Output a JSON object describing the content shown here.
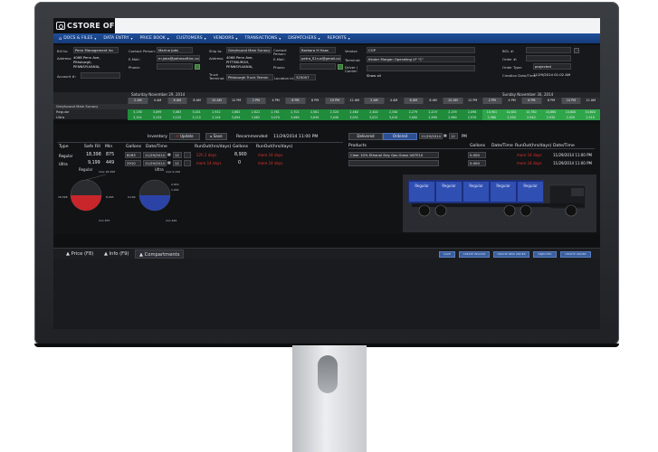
{
  "app": {
    "logo_text": "CSTORE OFFICE"
  },
  "menu": [
    {
      "label": "DOCS & FILES",
      "icon": "home-icon"
    },
    {
      "label": "DATA ENTRY"
    },
    {
      "label": "PRICE BOOK"
    },
    {
      "label": "CUSTOMERS"
    },
    {
      "label": "VENDORS"
    },
    {
      "label": "TRANSACTIONS"
    },
    {
      "label": "DISPATCHERS"
    },
    {
      "label": "REPORTS"
    }
  ],
  "billing": {
    "bill_to_label": "Bill to:",
    "bill_to_value": "Penn Management Inc",
    "address_label": "Address:",
    "address_lines": [
      "4068 Penn Ave,",
      "Pittsburgh,",
      "PENNSYLVANIA,"
    ],
    "account_label": "Account #:",
    "contact_label": "Contact Person:",
    "contact_value": "Marina Jobs",
    "email_label": "E-Mail:",
    "email_value": "m.jobs@petrosoftinc.co",
    "phone_label": "Phone:"
  },
  "shipping": {
    "ship_to_label": "Ship to:",
    "ship_to_value": "Greyhound Main Sunocy",
    "address_label": "Address:",
    "address_lines": [
      "4068 Penn Ave,",
      "PITTSBURGH,",
      "PENNSYLVANIA,"
    ],
    "truck_terminal_label": "Truck Terminal:",
    "truck_terminal_value": "Pittsburgh Truck Termin",
    "location_id_label": "Location Id:",
    "location_id_value": "325007",
    "contact_label": "Contact Person:",
    "contact_value": "Barbara H Haas",
    "email_label": "E-Mail:",
    "email_value": "petro_S1rus@gmail.com",
    "phone_label": "Phone:"
  },
  "vendor": {
    "vendor_label": "Vendor:",
    "vendor_value": "COP",
    "terminal_label": "Terminal:",
    "terminal_value": "Kinder Morgan Operating LP \"C\"",
    "driver_carrier_label": "Driver / Carrier:",
    "show_all": "Show all"
  },
  "order": {
    "bol_label": "BOL #:",
    "order_label": "Order #:",
    "order_type_label": "Order Type:",
    "order_type_value": "projected",
    "creation_label": "Creation Date/Time",
    "creation_value": "11/29/2014 01:02 AM"
  },
  "schedule": {
    "day1": "Saturday November 29, 2014",
    "day2": "Sunday November 30, 2014",
    "hours": [
      "2 AM",
      "4 AM",
      "6 AM",
      "8 AM",
      "10 AM",
      "12 PM",
      "2 PM",
      "4 PM",
      "6 PM",
      "8 PM",
      "10 PM",
      "12 AM",
      "2 AM",
      "4 AM",
      "6 AM",
      "8 AM",
      "10 AM",
      "12 PM",
      "2 PM",
      "4 PM",
      "6 PM",
      "8 PM",
      "10 PM",
      "12 AM"
    ],
    "rows": [
      {
        "label": "Greyhound Main Sunocy",
        "values": []
      },
      {
        "label": "Regular",
        "values": [
          "3,136",
          "3,099",
          "3,063",
          "3,001",
          "2,942",
          "2,882",
          "2,822",
          "2,761",
          "2,701",
          "2,581",
          "2,520",
          "2,460",
          "2,400",
          "2,340",
          "2,279",
          "2,219",
          "2,159",
          "2,098",
          "10,901",
          "10,841",
          "10,780",
          "10,660",
          "10,600",
          "10,600"
        ]
      },
      {
        "label": "Ultra",
        "values": [
          "3,144",
          "3,134",
          "3,125",
          "3,115",
          "3,104",
          "3,094",
          "3,082",
          "3,070",
          "3,060",
          "3,050",
          "3,040",
          "3,031",
          "3,021",
          "3,010",
          "3,000",
          "2,990",
          "2,980",
          "2,970",
          "2,960",
          "2,950",
          "2,940",
          "2,930",
          "2,920",
          "2,910"
        ]
      }
    ]
  },
  "inventory": {
    "title": "Inventory",
    "update_label": "Update",
    "save_label": "Save",
    "recommended_label": "Recommended",
    "recommended_value": "11/29/2014 11:00 PM",
    "columns": [
      "Type",
      "Safe Fill",
      "Min",
      "Gallons",
      "Date/Time",
      "RunOut(hrs/days)",
      "RunOut(hrs/days)"
    ],
    "rows": [
      {
        "type": "Regular",
        "safe_fill": "18,398",
        "min": "875",
        "gallons": "8263",
        "date": "11/29/2014",
        "hour": "12",
        "runout1": "22h 2 days",
        "rec_gallons": "8,900",
        "runout2": "more 14 days"
      },
      {
        "type": "Ultra",
        "safe_fill": "9,199",
        "min": "449",
        "gallons": "2910",
        "date": "11/29/2014",
        "hour": "12",
        "runout1": "more 14 days",
        "rec_gallons": "0",
        "runout2": "more 14 days"
      }
    ]
  },
  "products": {
    "delivered_label": "Delivered",
    "ordered_label": "Ordered",
    "date_value": "11/29/2014",
    "hour_value": "12",
    "ampm_value": "PM",
    "columns": [
      "Products",
      "Gallons",
      "Date/Time",
      "RunOut(hrs/days)",
      "Date/Time"
    ],
    "rows": [
      {
        "product": "Clear 10% Ethanol Dey Gas Gross U87E10",
        "gallons": "0.000",
        "runout": "more 14 days",
        "date": "11/29/2014 11:00 PM"
      },
      {
        "product": "",
        "gallons": "0.000",
        "runout": "more 14 days",
        "date": "11/29/2014 11:00 PM"
      }
    ]
  },
  "tanks": {
    "regular": {
      "label": "Regular",
      "max": "max 18,398",
      "min": "min 875",
      "left": "18,398",
      "right": "8,263",
      "fill_fraction": 0.45
    },
    "ultra": {
      "label": "Ultra",
      "max": "max 9,199",
      "min": "min 449",
      "right_top": "2,910",
      "right_bottom": "1,932",
      "left": "9,199",
      "fill_fraction": 0.32
    }
  },
  "truck": {
    "compartments": [
      "Regular",
      "Regular",
      "Regular",
      "Regular",
      "Regular"
    ],
    "colors": {
      "compartment": "#2f4fb3",
      "body": "#1e2f7d"
    }
  },
  "bottom_tabs": [
    {
      "label": "Price (F8)",
      "active": false
    },
    {
      "label": "Info (F9)",
      "active": false
    },
    {
      "label": "Compartments",
      "active": true
    }
  ],
  "actions": [
    "SAVE",
    "CREATE INVOICE",
    "CREATE NEW ORDER",
    "REJECTED",
    "DELETE ORDER"
  ],
  "colors": {
    "menu_blue": "#1e4e9a",
    "grid_green": "#1f8b3b",
    "alert_red": "#e0332f"
  }
}
